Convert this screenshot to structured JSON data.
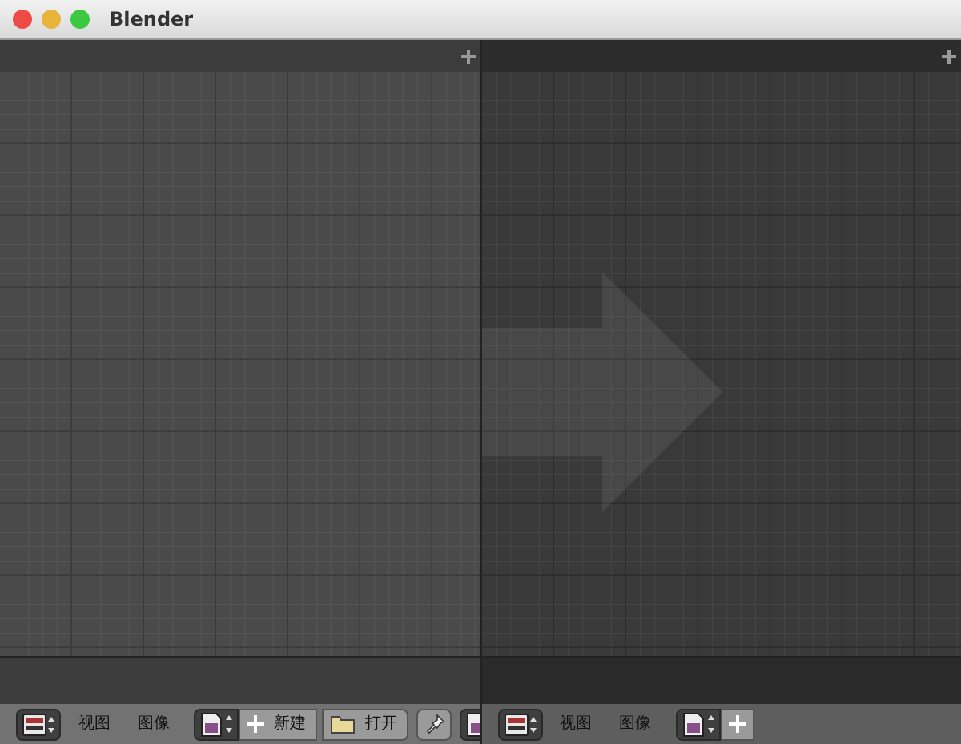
{
  "window": {
    "title": "Blender"
  },
  "panels": [
    {
      "active": true,
      "toolbar": {
        "menus": [
          "视图",
          "图像"
        ],
        "new_button": "新建",
        "open_button": "打开"
      }
    },
    {
      "active": false,
      "toolbar": {
        "menus": [
          "视图",
          "图像"
        ]
      }
    }
  ]
}
